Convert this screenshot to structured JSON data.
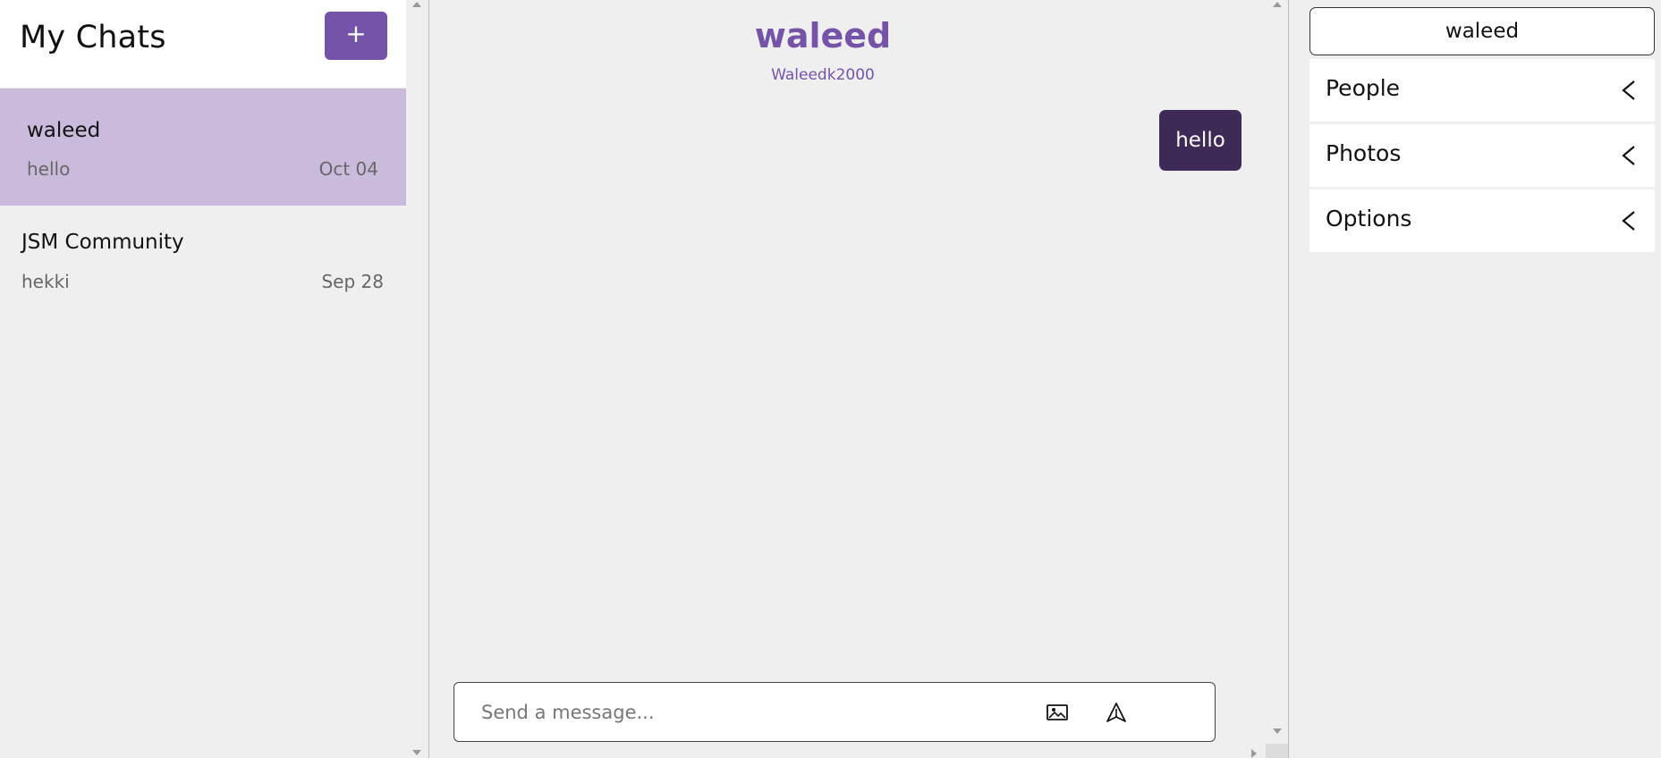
{
  "sidebar": {
    "title": "My Chats",
    "new_chat_label": "+",
    "chats": [
      {
        "name": "waleed",
        "preview": "hello",
        "date": "Oct 04",
        "active": true
      },
      {
        "name": "JSM Community",
        "preview": "hekki",
        "date": "Sep 28",
        "active": false
      }
    ]
  },
  "chat": {
    "title": "waleed",
    "subtitle": "Waleedk2000",
    "messages": [
      {
        "text": "hello",
        "own": true
      }
    ],
    "input": {
      "placeholder": "Send a message...",
      "value": ""
    },
    "icons": {
      "attach": "image-icon",
      "send": "send-icon"
    }
  },
  "settings": {
    "chat_name": "waleed",
    "sections": [
      {
        "label": "People"
      },
      {
        "label": "Photos"
      },
      {
        "label": "Options"
      }
    ]
  },
  "colors": {
    "accent": "#7553a8",
    "active_chat": "#cabbdd",
    "own_message": "#3e2a56",
    "background": "#efeff0"
  }
}
